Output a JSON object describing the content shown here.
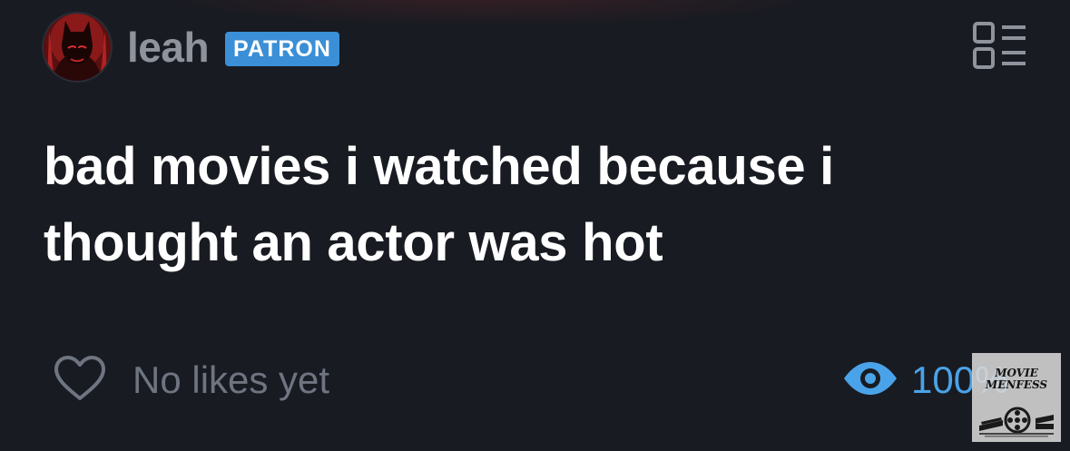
{
  "post": {
    "author": {
      "name": "leah",
      "badge": "PATRON"
    },
    "title": "bad movies i watched because i thought an actor was hot",
    "likes_text": "No likes yet",
    "views_text": "100%"
  },
  "watermark": {
    "line1": "MOVIE",
    "line2": "MENFESS"
  },
  "colors": {
    "background": "#181b22",
    "badge": "#3b8fd6",
    "accent_blue": "#4aa3e8",
    "muted_text": "#6f7580"
  },
  "icons": {
    "menu": "layout-list-icon",
    "like": "heart-outline-icon",
    "views": "eye-icon"
  }
}
